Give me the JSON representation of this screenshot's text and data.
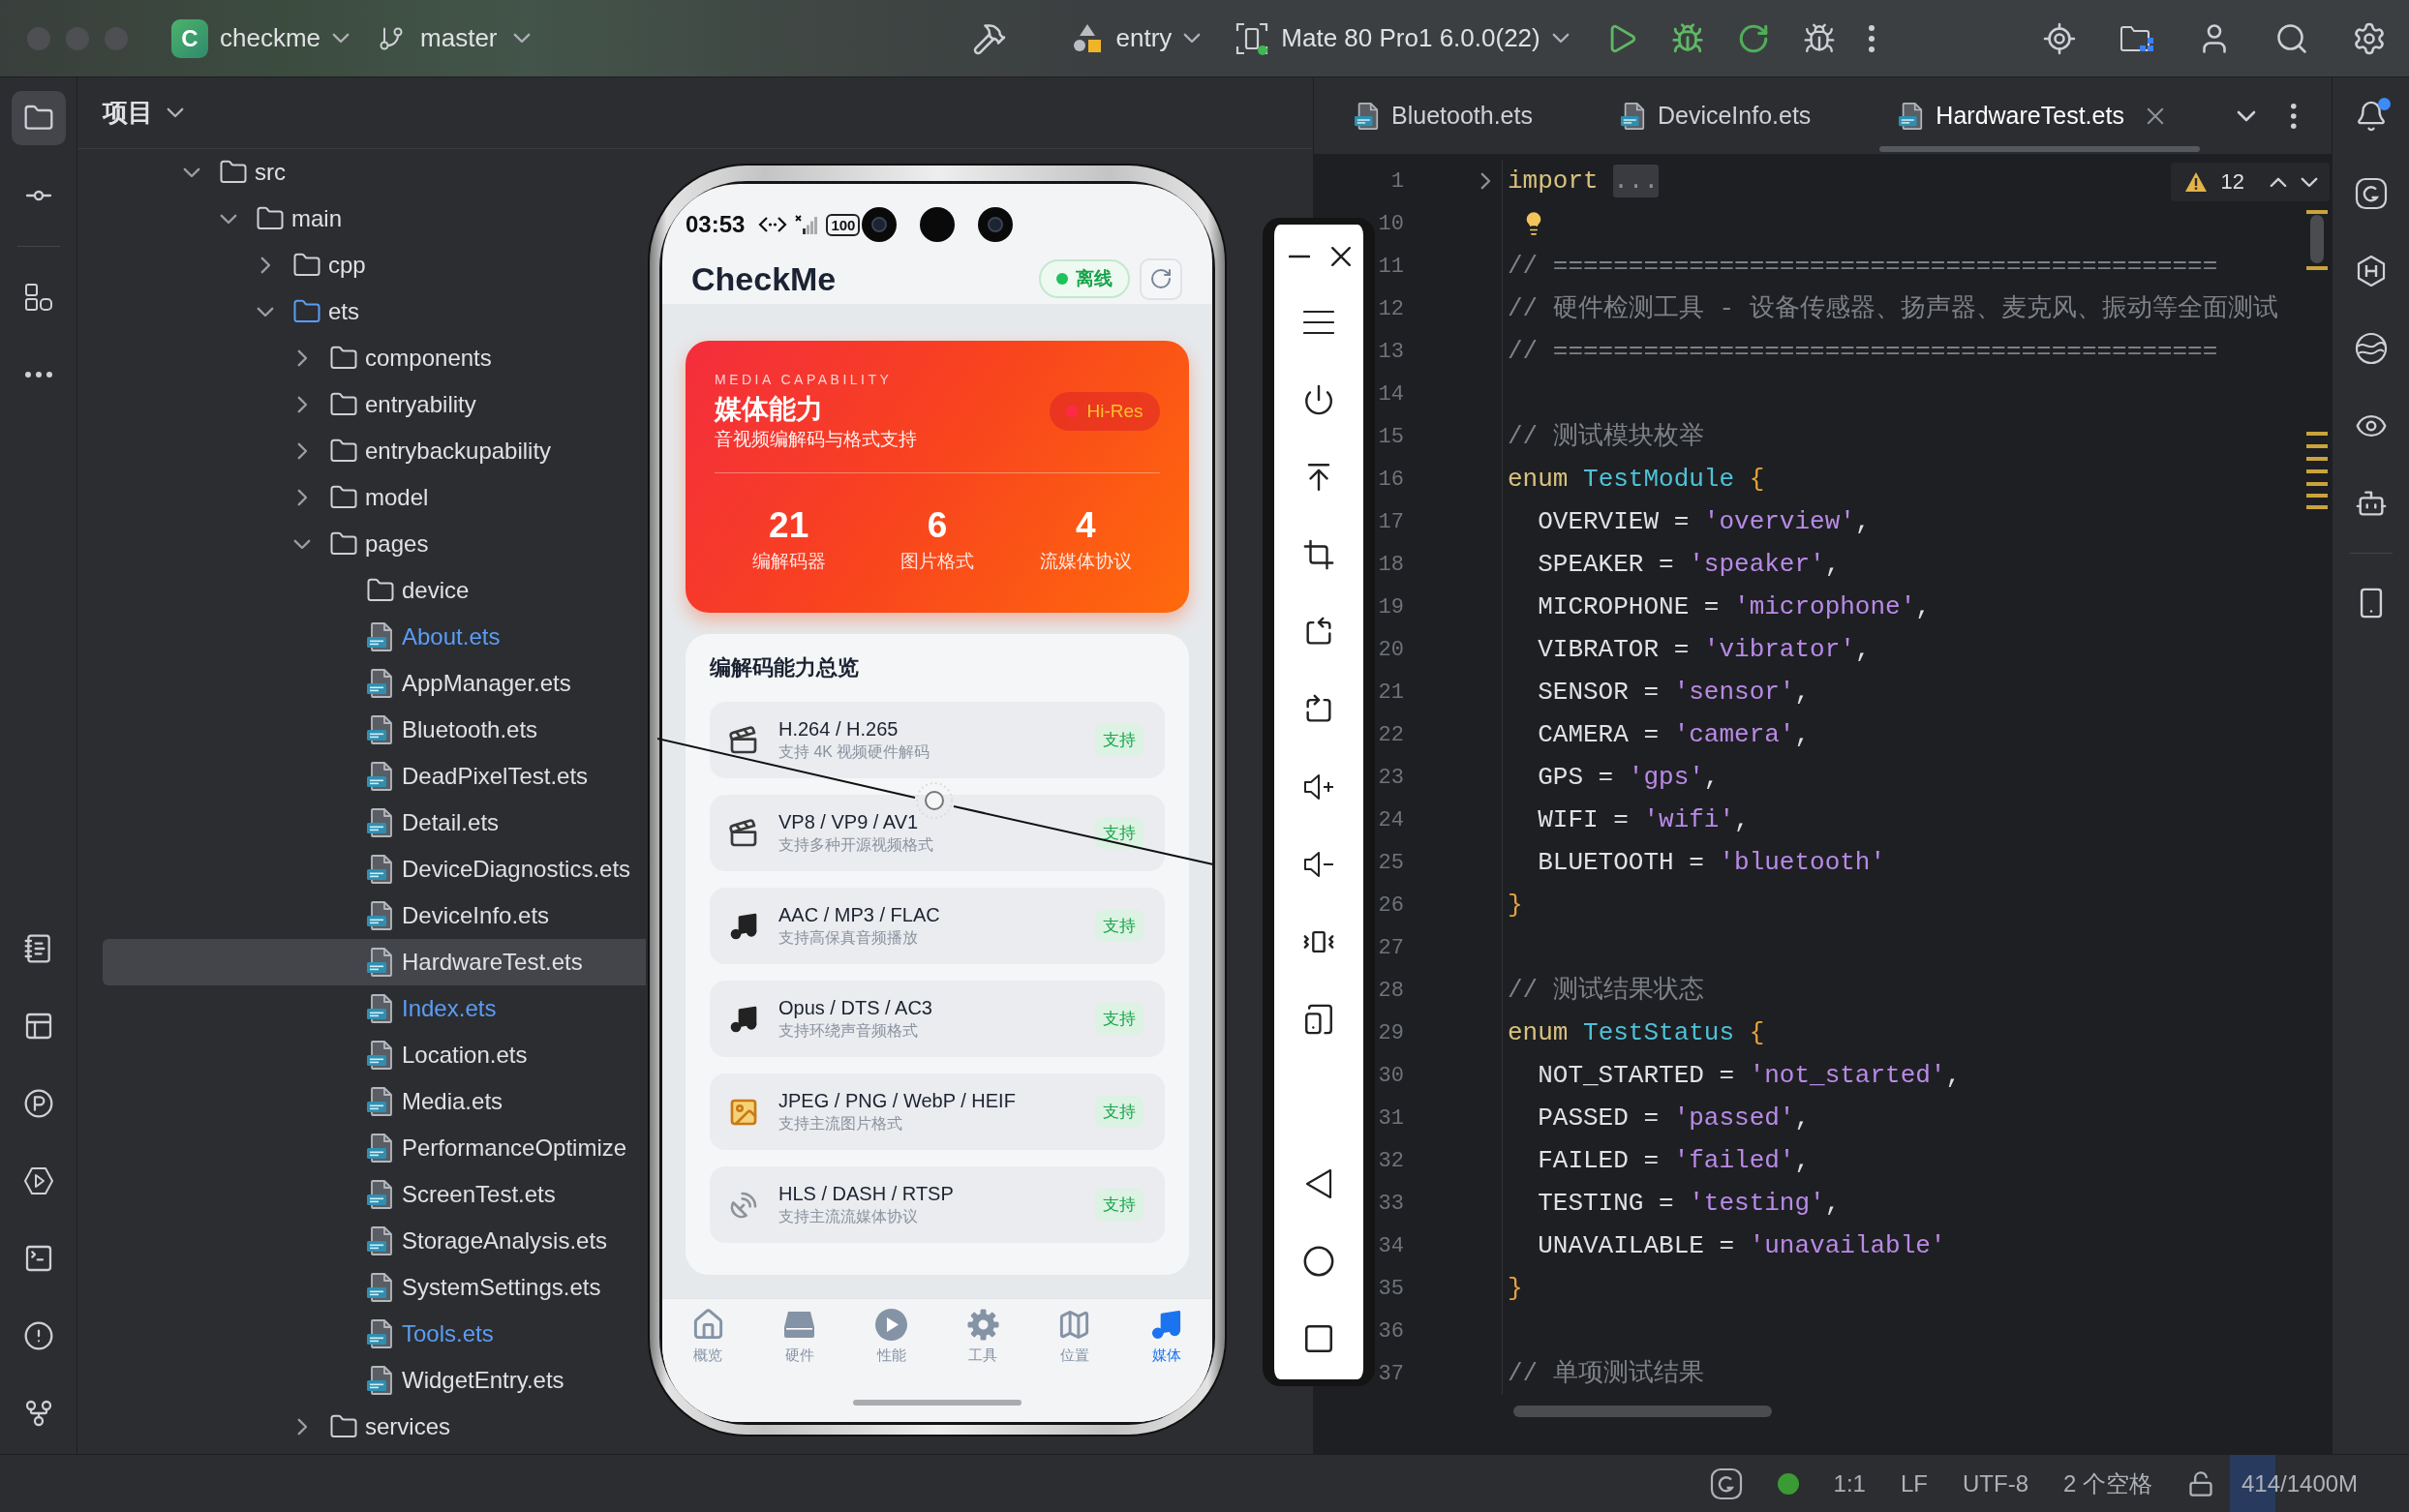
{
  "title_bar": {
    "project": {
      "initial": "C",
      "name": "checkme"
    },
    "branch": "master",
    "run_config": "entry",
    "device": "Mate 80 Pro1 6.0.0(22)"
  },
  "left_toolbar": {
    "top": [
      {
        "kind": "project",
        "selected": true
      },
      {
        "kind": "commit",
        "selected": false
      },
      {
        "kind": "structure",
        "selected": false
      },
      {
        "kind": "more",
        "selected": false
      }
    ],
    "bottom": [
      {
        "kind": "notes",
        "selected": false
      },
      {
        "kind": "layout",
        "selected": false
      },
      {
        "kind": "profiler",
        "selected": false
      },
      {
        "kind": "services",
        "selected": false
      },
      {
        "kind": "terminal",
        "selected": false
      },
      {
        "kind": "problems",
        "selected": false
      },
      {
        "kind": "git",
        "selected": false
      }
    ]
  },
  "project_panel": {
    "title": "项目",
    "tree": [
      {
        "kind": "folder",
        "name": "src",
        "expanded": true,
        "selected": false,
        "children": [
          {
            "kind": "folder",
            "name": "main",
            "expanded": true,
            "selected": false,
            "children": [
              {
                "kind": "folder",
                "name": "cpp",
                "expanded": false,
                "selected": false
              },
              {
                "kind": "source_folder",
                "name": "ets",
                "expanded": true,
                "selected": false,
                "children": [
                  {
                    "kind": "folder",
                    "name": "components",
                    "expanded": false,
                    "selected": false
                  },
                  {
                    "kind": "folder",
                    "name": "entryability",
                    "expanded": false,
                    "selected": false
                  },
                  {
                    "kind": "folder",
                    "name": "entrybackupability",
                    "expanded": false,
                    "selected": false
                  },
                  {
                    "kind": "folder",
                    "name": "model",
                    "expanded": false,
                    "selected": false
                  },
                  {
                    "kind": "folder",
                    "name": "pages",
                    "expanded": true,
                    "selected": false,
                    "children": [
                      {
                        "kind": "empty_folder",
                        "name": "device",
                        "selected": false
                      },
                      {
                        "kind": "file",
                        "name": "About.ets",
                        "modified": true,
                        "selected": false
                      },
                      {
                        "kind": "file",
                        "name": "AppManager.ets",
                        "modified": false,
                        "selected": false
                      },
                      {
                        "kind": "file",
                        "name": "Bluetooth.ets",
                        "modified": false,
                        "selected": false
                      },
                      {
                        "kind": "file",
                        "name": "DeadPixelTest.ets",
                        "modified": false,
                        "selected": false
                      },
                      {
                        "kind": "file",
                        "name": "Detail.ets",
                        "modified": false,
                        "selected": false
                      },
                      {
                        "kind": "file",
                        "name": "DeviceDiagnostics.ets",
                        "modified": false,
                        "selected": false
                      },
                      {
                        "kind": "file",
                        "name": "DeviceInfo.ets",
                        "modified": false,
                        "selected": false
                      },
                      {
                        "kind": "file",
                        "name": "HardwareTest.ets",
                        "modified": false,
                        "selected": true
                      },
                      {
                        "kind": "file",
                        "name": "Index.ets",
                        "modified": true,
                        "selected": false
                      },
                      {
                        "kind": "file",
                        "name": "Location.ets",
                        "modified": false,
                        "selected": false
                      },
                      {
                        "kind": "file",
                        "name": "Media.ets",
                        "modified": false,
                        "selected": false
                      },
                      {
                        "kind": "file",
                        "name": "PerformanceOptimize",
                        "modified": false,
                        "selected": false
                      },
                      {
                        "kind": "file",
                        "name": "ScreenTest.ets",
                        "modified": false,
                        "selected": false
                      },
                      {
                        "kind": "file",
                        "name": "StorageAnalysis.ets",
                        "modified": false,
                        "selected": false
                      },
                      {
                        "kind": "file",
                        "name": "SystemSettings.ets",
                        "modified": false,
                        "selected": false
                      },
                      {
                        "kind": "file",
                        "name": "Tools.ets",
                        "modified": true,
                        "selected": false
                      },
                      {
                        "kind": "file",
                        "name": "WidgetEntry.ets",
                        "modified": false,
                        "selected": false
                      }
                    ]
                  },
                  {
                    "kind": "folder",
                    "name": "services",
                    "expanded": false,
                    "selected": false
                  }
                ]
              }
            ]
          }
        ]
      }
    ]
  },
  "editor": {
    "tabs": [
      {
        "name": "Bluetooth.ets",
        "selected": false
      },
      {
        "name": "DeviceInfo.ets",
        "selected": false
      },
      {
        "name": "HardwareTest.ets",
        "selected": true
      }
    ],
    "warnings": "12",
    "lines": [
      {
        "number": "1",
        "kind": "folded",
        "tokens": [
          {
            "kind": "keyword",
            "text": "import "
          },
          {
            "kind": "fold",
            "text": "..."
          }
        ]
      },
      {
        "number": "10",
        "kind": "code",
        "tokens": [
          {
            "kind": "bulb"
          }
        ]
      },
      {
        "number": "11",
        "kind": "code",
        "tokens": [
          {
            "kind": "comment",
            "text": "// ============================================"
          }
        ]
      },
      {
        "number": "12",
        "kind": "code",
        "tokens": [
          {
            "kind": "comment",
            "text": "// 硬件检测工具 - 设备传感器、扬声器、麦克风、振动等全面测试"
          }
        ]
      },
      {
        "number": "13",
        "kind": "code",
        "tokens": [
          {
            "kind": "comment",
            "text": "// ============================================"
          }
        ]
      },
      {
        "number": "14",
        "kind": "code"
      },
      {
        "number": "15",
        "kind": "code",
        "tokens": [
          {
            "kind": "comment",
            "text": "// 测试模块枚举"
          }
        ]
      },
      {
        "number": "16",
        "kind": "code",
        "tokens": [
          {
            "kind": "keyword",
            "text": "enum"
          },
          {
            "kind": "type",
            "text": " TestModule"
          },
          {
            "kind": "brace",
            "text": " {"
          }
        ]
      },
      {
        "number": "17",
        "kind": "code",
        "tokens": [
          {
            "kind": "plain",
            "text": "  OVERVIEW = "
          },
          {
            "kind": "string",
            "text": "'overview'"
          },
          {
            "kind": "plain",
            "text": ","
          }
        ]
      },
      {
        "number": "18",
        "kind": "code",
        "tokens": [
          {
            "kind": "plain",
            "text": "  SPEAKER = "
          },
          {
            "kind": "string",
            "text": "'speaker'"
          },
          {
            "kind": "plain",
            "text": ","
          }
        ]
      },
      {
        "number": "19",
        "kind": "code",
        "tokens": [
          {
            "kind": "plain",
            "text": "  MICROPHONE = "
          },
          {
            "kind": "string",
            "text": "'microphone'"
          },
          {
            "kind": "plain",
            "text": ","
          }
        ]
      },
      {
        "number": "20",
        "kind": "code",
        "tokens": [
          {
            "kind": "plain",
            "text": "  VIBRATOR = "
          },
          {
            "kind": "string",
            "text": "'vibrator'"
          },
          {
            "kind": "plain",
            "text": ","
          }
        ]
      },
      {
        "number": "21",
        "kind": "code",
        "tokens": [
          {
            "kind": "plain",
            "text": "  SENSOR = "
          },
          {
            "kind": "string",
            "text": "'sensor'"
          },
          {
            "kind": "plain",
            "text": ","
          }
        ]
      },
      {
        "number": "22",
        "kind": "code",
        "tokens": [
          {
            "kind": "plain",
            "text": "  CAMERA = "
          },
          {
            "kind": "string",
            "text": "'camera'"
          },
          {
            "kind": "plain",
            "text": ","
          }
        ]
      },
      {
        "number": "23",
        "kind": "code",
        "tokens": [
          {
            "kind": "plain",
            "text": "  GPS = "
          },
          {
            "kind": "string",
            "text": "'gps'"
          },
          {
            "kind": "plain",
            "text": ","
          }
        ]
      },
      {
        "number": "24",
        "kind": "code",
        "tokens": [
          {
            "kind": "plain",
            "text": "  WIFI = "
          },
          {
            "kind": "string",
            "text": "'wifi'"
          },
          {
            "kind": "plain",
            "text": ","
          }
        ]
      },
      {
        "number": "25",
        "kind": "code",
        "tokens": [
          {
            "kind": "plain",
            "text": "  BLUETOOTH = "
          },
          {
            "kind": "string",
            "text": "'bluetooth'"
          }
        ]
      },
      {
        "number": "26",
        "kind": "code",
        "tokens": [
          {
            "kind": "brace",
            "text": "}"
          }
        ]
      },
      {
        "number": "27",
        "kind": "code"
      },
      {
        "number": "28",
        "kind": "code",
        "tokens": [
          {
            "kind": "comment",
            "text": "// 测试结果状态"
          }
        ]
      },
      {
        "number": "29",
        "kind": "code",
        "tokens": [
          {
            "kind": "keyword",
            "text": "enum"
          },
          {
            "kind": "type",
            "text": " TestStatus"
          },
          {
            "kind": "brace",
            "text": " {"
          }
        ]
      },
      {
        "number": "30",
        "kind": "code",
        "tokens": [
          {
            "kind": "plain",
            "text": "  NOT_STARTED = "
          },
          {
            "kind": "string",
            "text": "'not_started'"
          },
          {
            "kind": "plain",
            "text": ","
          }
        ]
      },
      {
        "number": "31",
        "kind": "code",
        "tokens": [
          {
            "kind": "plain",
            "text": "  PASSED = "
          },
          {
            "kind": "string",
            "text": "'passed'"
          },
          {
            "kind": "plain",
            "text": ","
          }
        ]
      },
      {
        "number": "32",
        "kind": "code",
        "tokens": [
          {
            "kind": "plain",
            "text": "  FAILED = "
          },
          {
            "kind": "string",
            "text": "'failed'"
          },
          {
            "kind": "plain",
            "text": ","
          }
        ]
      },
      {
        "number": "33",
        "kind": "code",
        "tokens": [
          {
            "kind": "plain",
            "text": "  TESTING = "
          },
          {
            "kind": "string",
            "text": "'testing'"
          },
          {
            "kind": "plain",
            "text": ","
          }
        ]
      },
      {
        "number": "34",
        "kind": "code",
        "tokens": [
          {
            "kind": "plain",
            "text": "  UNAVAILABLE = "
          },
          {
            "kind": "string",
            "text": "'unavailable'"
          }
        ]
      },
      {
        "number": "35",
        "kind": "code",
        "tokens": [
          {
            "kind": "brace",
            "text": "}"
          }
        ]
      },
      {
        "number": "36",
        "kind": "code"
      },
      {
        "number": "37",
        "kind": "code",
        "tokens": [
          {
            "kind": "comment",
            "text": "// 单项测试结果"
          }
        ]
      }
    ]
  },
  "right_toolbar": {
    "notifications_unread": true
  },
  "emulator": {
    "status_bar": {
      "time": "03:53",
      "battery": "100"
    },
    "header": {
      "title": "CheckMe",
      "status": "离线"
    },
    "hero": {
      "eyebrow": "MEDIA CAPABILITY",
      "title": "媒体能力",
      "subtitle": "音视频编解码与格式支持",
      "badge": "Hi-Res",
      "stats": [
        {
          "value": "21",
          "label": "编解码器"
        },
        {
          "value": "6",
          "label": "图片格式"
        },
        {
          "value": "4",
          "label": "流媒体协议"
        }
      ]
    },
    "codec_card": {
      "title": "编解码能力总览",
      "items": [
        {
          "kind": "video",
          "name": "H.264 / H.265",
          "description": "支持 4K 视频硬件解码",
          "status": "支持"
        },
        {
          "kind": "video",
          "name": "VP8 / VP9 / AV1",
          "description": "支持多种开源视频格式",
          "status": "支持"
        },
        {
          "kind": "audio",
          "name": "AAC / MP3 / FLAC",
          "description": "支持高保真音频播放",
          "status": "支持"
        },
        {
          "kind": "audio",
          "name": "Opus / DTS / AC3",
          "description": "支持环绕声音频格式",
          "status": "支持"
        },
        {
          "kind": "image",
          "name": "JPEG / PNG / WebP / HEIF",
          "description": "支持主流图片格式",
          "status": "支持"
        },
        {
          "kind": "stream",
          "name": "HLS / DASH / RTSP",
          "description": "支持主流流媒体协议",
          "status": "支持"
        }
      ]
    },
    "tab_bar": [
      {
        "kind": "home",
        "label": "概览",
        "selected": false
      },
      {
        "kind": "hardware",
        "label": "硬件",
        "selected": false
      },
      {
        "kind": "performance",
        "label": "性能",
        "selected": false
      },
      {
        "kind": "tools",
        "label": "工具",
        "selected": false
      },
      {
        "kind": "location",
        "label": "位置",
        "selected": false
      },
      {
        "kind": "media",
        "label": "媒体",
        "selected": true
      }
    ]
  },
  "status_bar": {
    "position": "1:1",
    "line_separator": "LF",
    "encoding": "UTF-8",
    "indent": "2 个空格",
    "memory": {
      "text": "414/1400M",
      "level": 0.296
    }
  }
}
